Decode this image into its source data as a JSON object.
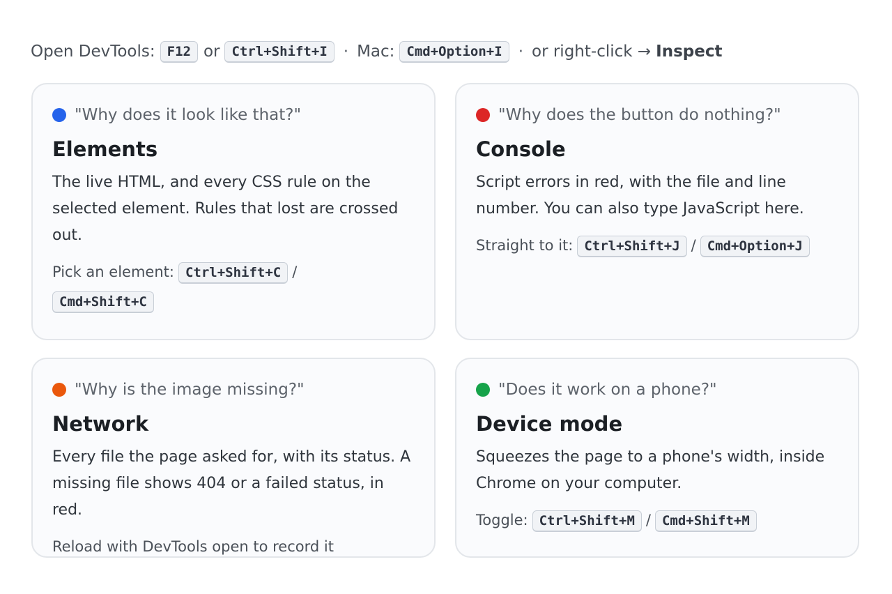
{
  "header": {
    "open_label": "Open DevTools:",
    "key_f12": "F12",
    "or_text": "or",
    "key_win": "Ctrl+Shift+I",
    "separator_1": "·",
    "mac_label": "Mac:",
    "key_mac": "Cmd+Option+I",
    "separator_2": "·",
    "right_click_text": "or right-click →",
    "inspect_label": "Inspect"
  },
  "cards": [
    {
      "question": "\"Why does it look like that?\"",
      "dot_color": "#2563eb",
      "title": "Elements",
      "description": "The live HTML, and every CSS rule on the selected element. Rules that lost are crossed out.",
      "tip_label": "Pick an element:",
      "key_win": "Ctrl+Shift+C",
      "slash": "/",
      "key_mac": "Cmd+Shift+C"
    },
    {
      "question": "\"Why does the button do nothing?\"",
      "dot_color": "#dc2626",
      "title": "Console",
      "description": "Script errors in red, with the file and line number. You can also type JavaScript here.",
      "tip_label": "Straight to it:",
      "key_win": "Ctrl+Shift+J",
      "slash": "/",
      "key_mac": "Cmd+Option+J"
    },
    {
      "question": "\"Why is the image missing?\"",
      "dot_color": "#ea580c",
      "title": "Network",
      "description": "Every file the page asked for, with its status. A missing file shows 404 or a failed status, in red.",
      "tip_label": "Reload with DevTools open to record it"
    },
    {
      "question": "\"Does it work on a phone?\"",
      "dot_color": "#16a34a",
      "title": "Device mode",
      "description": "Squeezes the page to a phone's width, inside Chrome on your computer.",
      "tip_label": "Toggle:",
      "key_win": "Ctrl+Shift+M",
      "slash": "/",
      "key_mac": "Cmd+Shift+M"
    }
  ]
}
